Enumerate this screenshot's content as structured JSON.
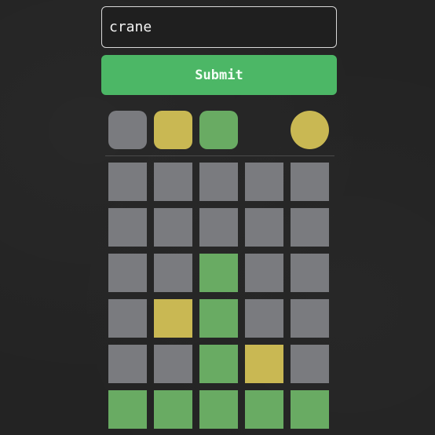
{
  "input": {
    "value": "crane",
    "placeholder": ""
  },
  "submit": {
    "label": "Submit"
  },
  "colors": {
    "background": "#232323",
    "absent": "#7a7b7f",
    "present": "#c9b853",
    "correct": "#69ab63",
    "button": "#4cb766"
  },
  "legend": [
    {
      "name": "legend-gray-swatch",
      "state": "absent",
      "shape": "rounded-square"
    },
    {
      "name": "legend-yellow-swatch",
      "state": "present",
      "shape": "rounded-square"
    },
    {
      "name": "legend-green-swatch",
      "state": "correct",
      "shape": "rounded-square"
    },
    {
      "name": "legend-yellow-circle",
      "state": "present",
      "shape": "circle"
    }
  ],
  "board": {
    "rows": [
      [
        "absent",
        "absent",
        "absent",
        "absent",
        "absent"
      ],
      [
        "absent",
        "absent",
        "absent",
        "absent",
        "absent"
      ],
      [
        "absent",
        "absent",
        "correct",
        "absent",
        "absent"
      ],
      [
        "absent",
        "present",
        "correct",
        "absent",
        "absent"
      ],
      [
        "absent",
        "absent",
        "correct",
        "present",
        "absent"
      ],
      [
        "correct",
        "correct",
        "correct",
        "correct",
        "correct"
      ]
    ]
  }
}
